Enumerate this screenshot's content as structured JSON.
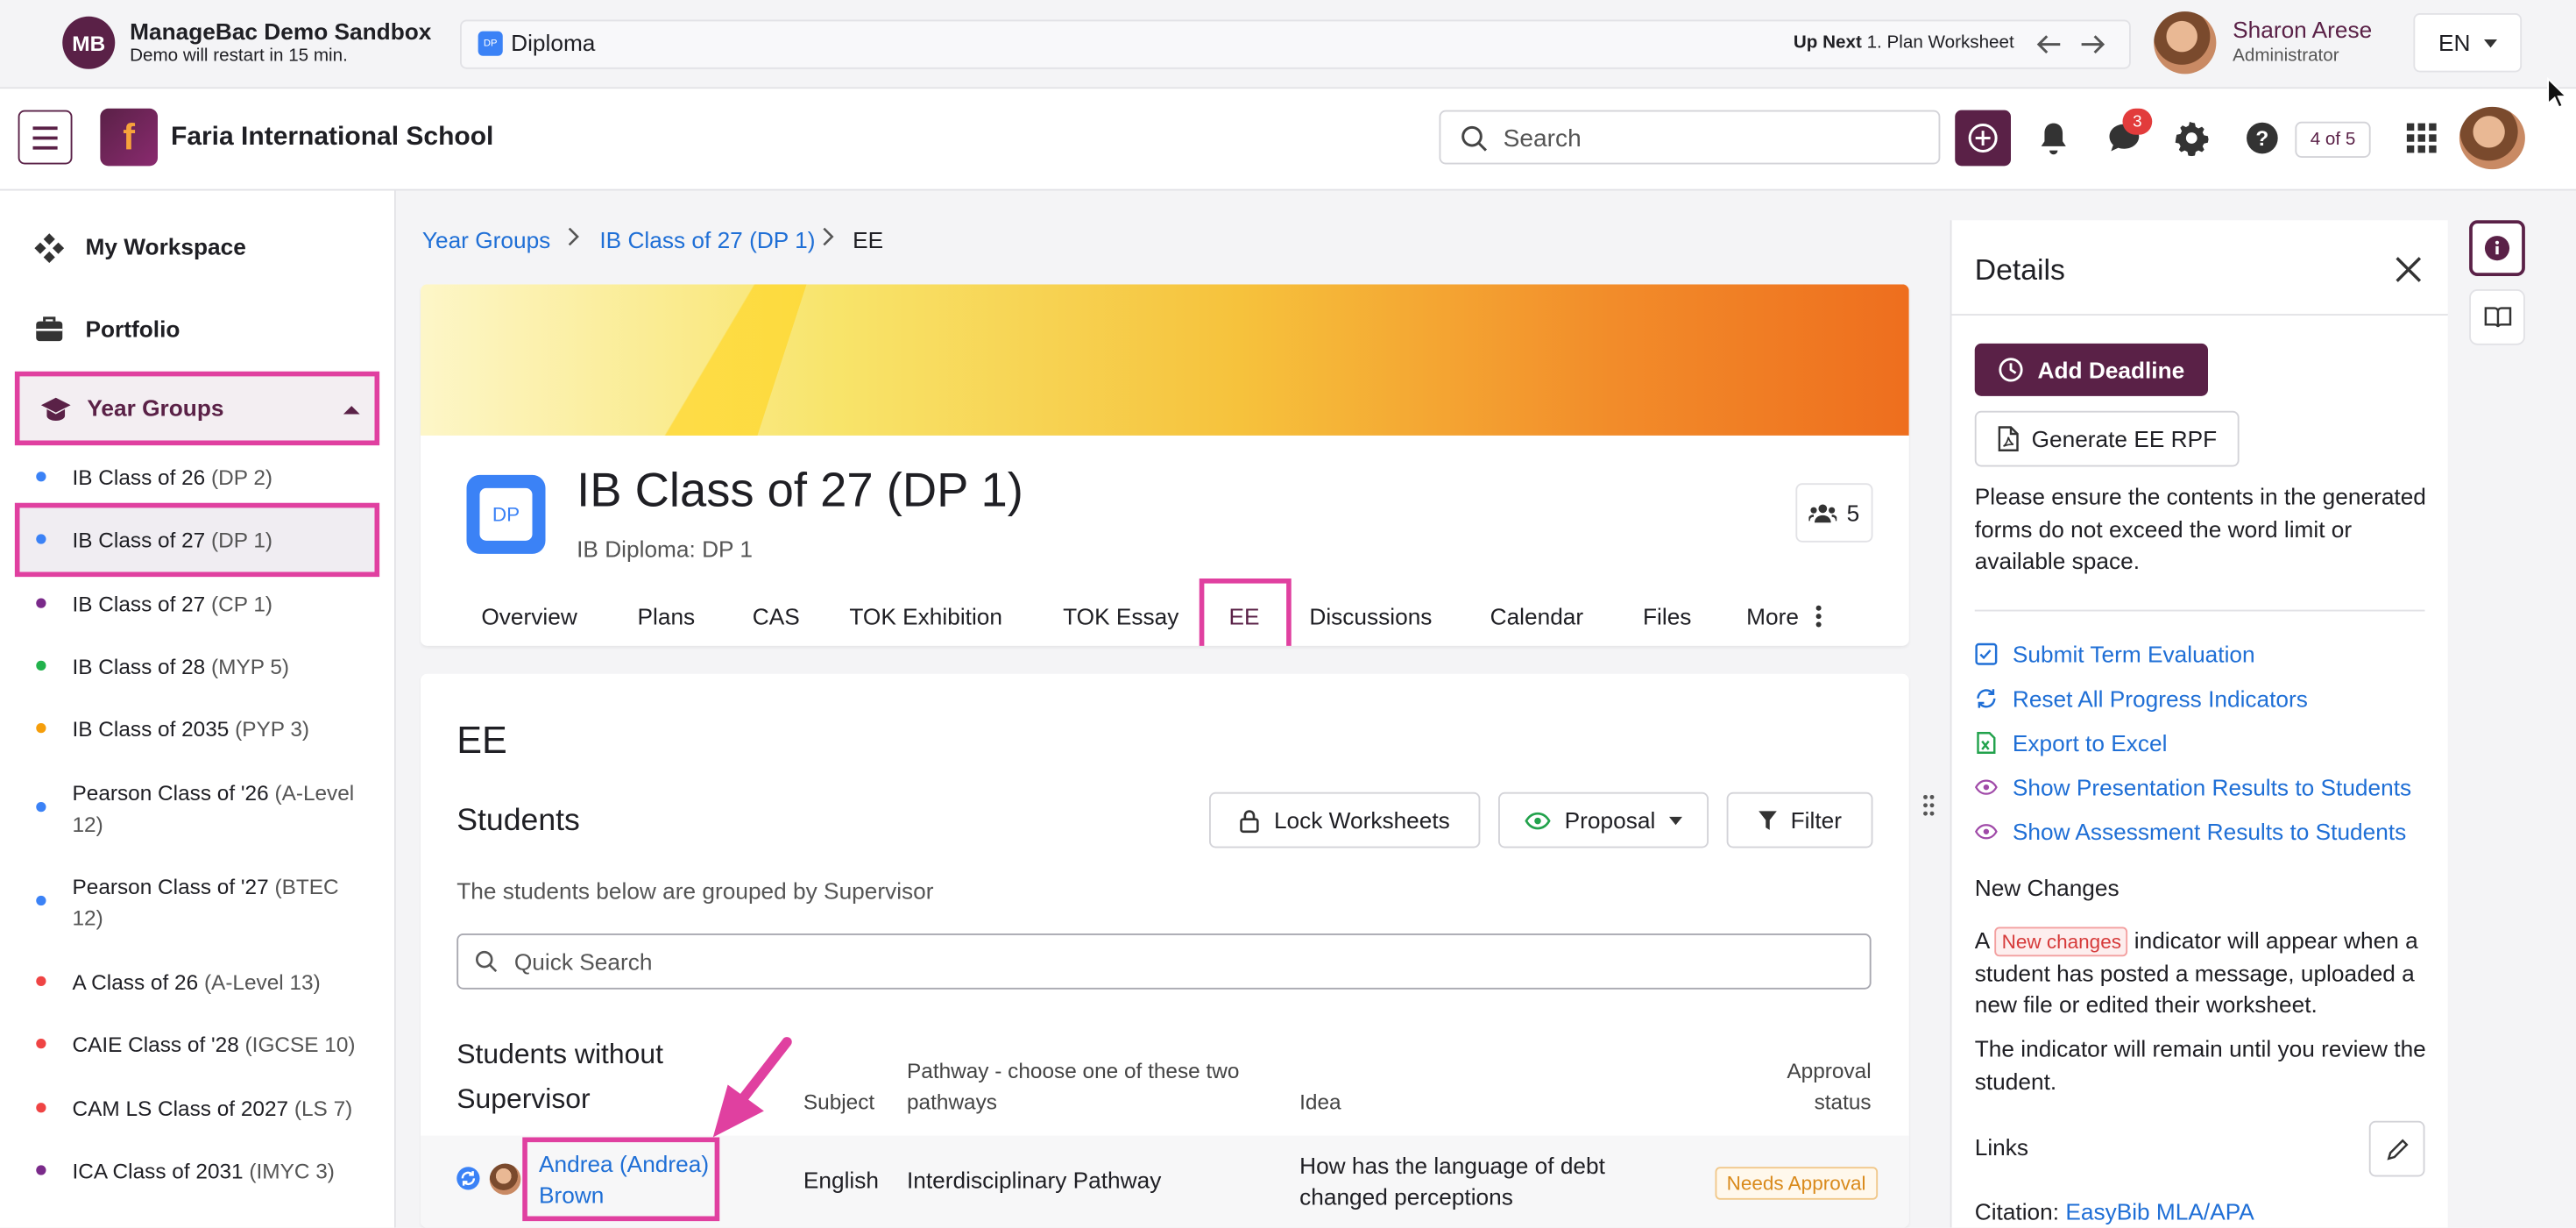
{
  "demo": {
    "logo": "MB",
    "title": "ManageBac Demo Sandbox",
    "subtitle": "Demo will restart in 15 min.",
    "program": "Diploma",
    "program_icon_text": "DP",
    "up_next_label": "Up Next",
    "up_next_item": "1. Plan Worksheet"
  },
  "user": {
    "name": "Sharon Arese",
    "role": "Administrator"
  },
  "language": "EN",
  "header": {
    "school_name": "Faria International School",
    "school_logo": "f",
    "search_placeholder": "Search",
    "messages_badge": "3",
    "page_count": "4 of 5"
  },
  "sidebar": {
    "workspace": "My Workspace",
    "portfolio": "Portfolio",
    "year_groups": "Year Groups",
    "items": [
      {
        "name": "IB Class of 26",
        "tag": "(DP 2)",
        "color": "#3b82f6"
      },
      {
        "name": "IB Class of 27",
        "tag": "(DP 1)",
        "color": "#3b82f6"
      },
      {
        "name": "IB Class of 27",
        "tag": "(CP 1)",
        "color": "#7a2a8a"
      },
      {
        "name": "IB Class of 28",
        "tag": "(MYP 5)",
        "color": "#22b24c"
      },
      {
        "name": "IB Class of 2035",
        "tag": "(PYP 3)",
        "color": "#f59e0b"
      },
      {
        "name": "Pearson Class of '26",
        "tag": "(A-Level 12)",
        "color": "#3b82f6"
      },
      {
        "name": "Pearson Class of '27",
        "tag": "(BTEC 12)",
        "color": "#3b82f6"
      },
      {
        "name": "A Class of 26",
        "tag": "(A-Level 13)",
        "color": "#ef4444"
      },
      {
        "name": "CAIE Class of '28",
        "tag": "(IGCSE 10)",
        "color": "#ef4444"
      },
      {
        "name": "CAM LS Class of 2027",
        "tag": "(LS 7)",
        "color": "#ef4444"
      },
      {
        "name": "ICA Class of 2031",
        "tag": "(IMYC 3)",
        "color": "#7a2a8a"
      }
    ]
  },
  "breadcrumb": [
    "Year Groups",
    "IB Class of 27 (DP 1)",
    "EE"
  ],
  "class": {
    "title": "IB Class of 27 (DP 1)",
    "subtitle": "IB Diploma: DP 1",
    "logo_text": "DP",
    "members": "5",
    "tabs": [
      "Overview",
      "Plans",
      "CAS",
      "TOK Exhibition",
      "TOK Essay",
      "EE",
      "Discussions",
      "Calendar",
      "Files",
      "More"
    ]
  },
  "ee": {
    "heading": "EE",
    "students_heading": "Students",
    "lock_label": "Lock Worksheets",
    "proposal_label": "Proposal",
    "filter_label": "Filter",
    "grouped_note": "The students below are grouped by Supervisor",
    "quick_search": "Quick Search",
    "group_heading": "Students without Supervisor",
    "columns": {
      "subject": "Subject",
      "pathway": "Pathway - choose one of these two pathways",
      "idea": "Idea",
      "approval": "Approval status"
    },
    "rows": [
      {
        "student": "Andrea (Andrea) Brown",
        "subject": "English",
        "pathway": "Interdisciplinary Pathway",
        "idea": "How has the language of debt changed perceptions",
        "status": "Needs Approval"
      }
    ]
  },
  "details": {
    "title": "Details",
    "add_deadline": "Add Deadline",
    "generate_rpf": "Generate EE RPF",
    "note": "Please ensure the contents in the generated forms do not exceed the word limit or available space.",
    "links": [
      {
        "label": "Submit Term Evaluation",
        "icon": "checklist-icon"
      },
      {
        "label": "Reset All Progress Indicators",
        "icon": "refresh-icon"
      },
      {
        "label": "Export to Excel",
        "icon": "excel-icon"
      },
      {
        "label": "Show Presentation Results to Students",
        "icon": "eye-icon"
      },
      {
        "label": "Show Assessment Results to Students",
        "icon": "eye-icon"
      }
    ],
    "new_changes_heading": "New Changes",
    "nc_pre": "A",
    "nc_pill": "New changes",
    "nc_post": "indicator will appear when a student has posted a message, uploaded a new file or edited their worksheet.",
    "nc_para2": "The indicator will remain until you review the student.",
    "links_heading": "Links",
    "citation_label": "Citation:",
    "citation_link": "EasyBib MLA/APA"
  },
  "colors": {
    "brand": "#5a2147",
    "highlight": "#e040a0",
    "link": "#1f6fd6"
  }
}
